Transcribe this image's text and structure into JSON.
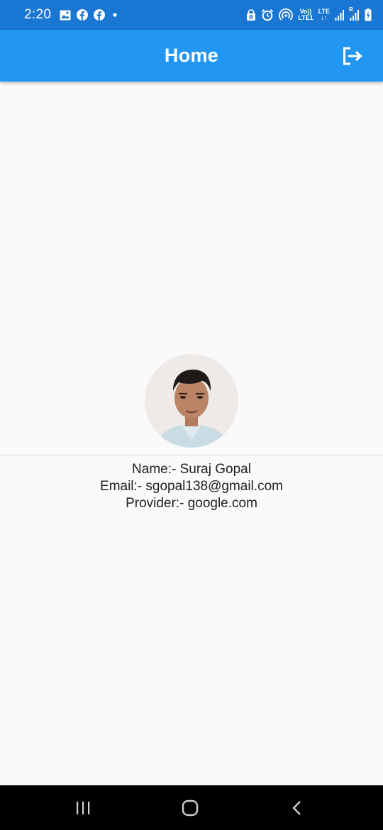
{
  "status_bar": {
    "time": "2:20",
    "volte_top": "Vo))",
    "volte_bottom": "LTE1",
    "lte_top": "LTE",
    "lte_bottom": "↓↑",
    "sim2_label": "R",
    "icons": [
      "image-icon",
      "facebook-icon",
      "facebook-icon",
      "dot-icon",
      "alarm-lock-icon",
      "alarm-clock-icon",
      "hotspot-icon",
      "signal-icon",
      "signal-icon",
      "battery-charging-icon"
    ]
  },
  "app_bar": {
    "title": "Home",
    "action_icon": "logout-icon"
  },
  "profile": {
    "avatar_alt": "avatar",
    "name_line": "Name:- Suraj Gopal",
    "email_line": "Email:- sgopal138@gmail.com",
    "provider_line": "Provider:- google.com"
  },
  "nav_bar": {
    "icons": [
      "recents-icon",
      "home-icon",
      "back-icon"
    ]
  },
  "colors": {
    "status_bar": "#1976d2",
    "app_bar": "#2196f3",
    "background": "#fafafa",
    "nav_bar": "#000000"
  }
}
